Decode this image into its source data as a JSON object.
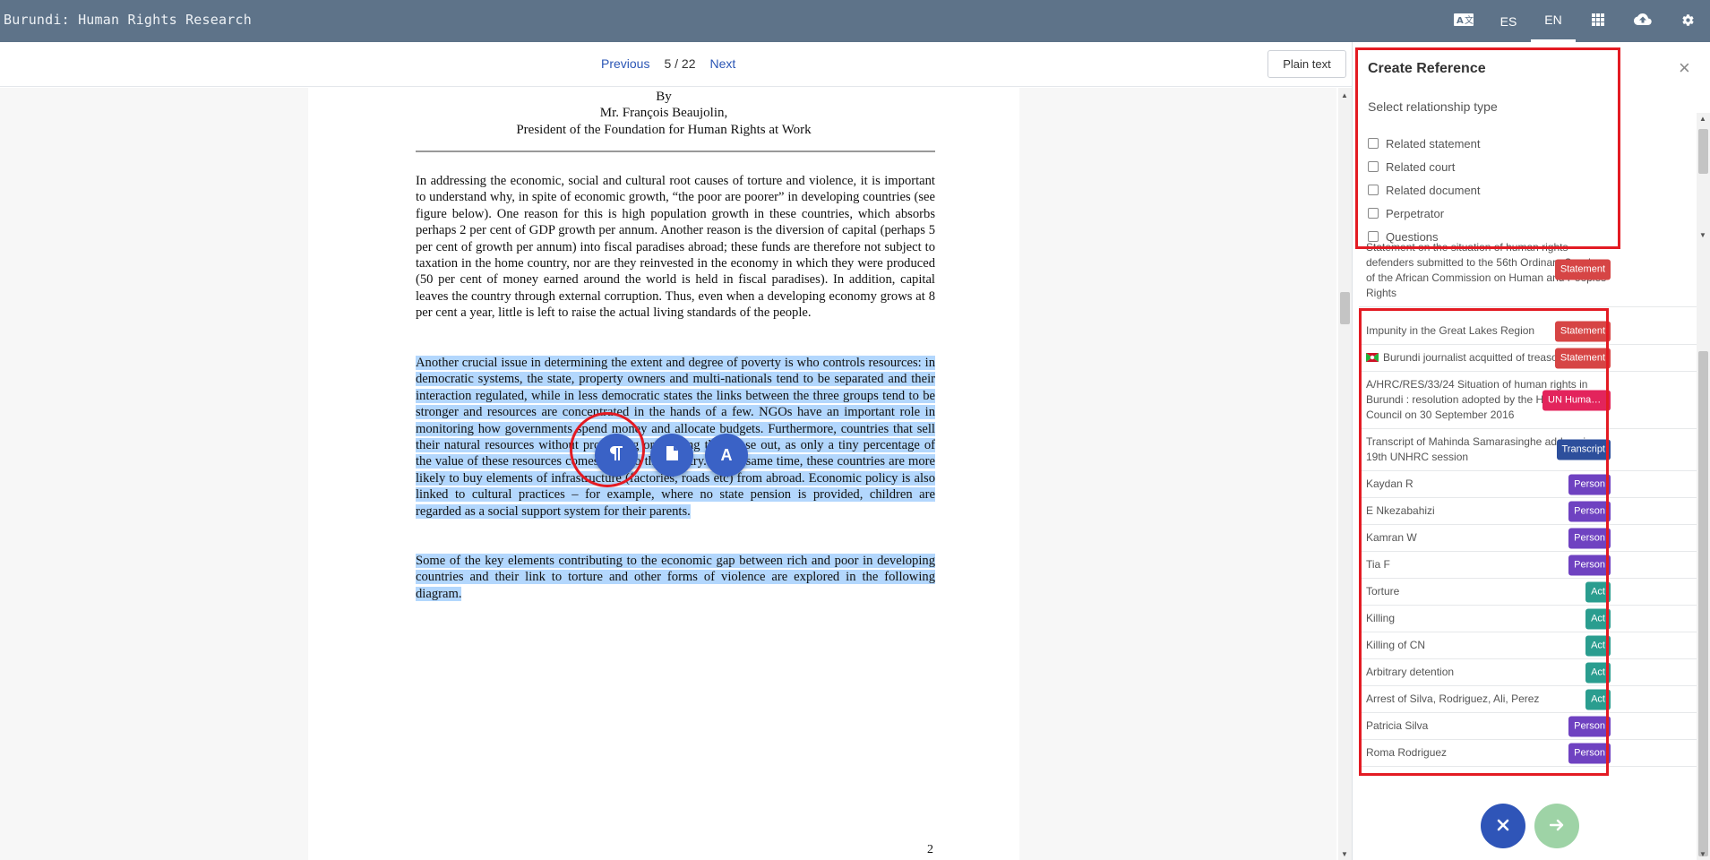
{
  "app": {
    "title": "Burundi: Human Rights Research"
  },
  "topbar": {
    "translate_icon": "translate-icon",
    "languages": [
      {
        "code": "ES",
        "active": false
      },
      {
        "code": "EN",
        "active": true
      }
    ],
    "apps_icon": "apps-grid-icon",
    "upload_icon": "cloud-upload-icon",
    "settings_icon": "gear-icon"
  },
  "viewer": {
    "previous": "Previous",
    "page_count": "5 / 22",
    "next": "Next",
    "plain_text": "Plain text"
  },
  "document": {
    "by": "By",
    "author": "Mr. François Beaujolin,",
    "role": "President of the Foundation for Human Rights at Work",
    "para1": "In addressing the economic, social and cultural root causes of torture and violence, it is important to understand why, in spite of economic growth, “the poor are poorer” in developing countries (see figure below). One reason for this is high population growth in these countries, which absorbs perhaps 2 per cent of GDP growth per annum. Another reason is the diversion of capital (perhaps 5 per cent of growth per annum) into fiscal paradises abroad; these funds are therefore not subject to taxation in the home country, nor are they reinvested in the economy in which they were produced (50 per cent of money earned around the world is held in fiscal paradises). In addition, capital leaves the country through external corruption. Thus, even when a developing economy grows at 8 per cent a year, little is left to raise the actual living standards of the people.",
    "para2": "Another crucial issue in determining the extent and degree of poverty is who controls resources: in democratic systems, the state, property owners and multi-nationals tend to be separated and their interaction regulated, while in less democratic states the links between the three groups tend to be stronger and resources are concentrated in the hands of a few. NGOs have an important role in monitoring how governments spend money and allocate budgets. Furthermore, countries that sell their natural resources without processing or refining them lose out, as only a tiny percentage of the value of these resources comes back to the country. At the same time, these countries are more likely to buy elements of infrastructure (factories, roads etc) from abroad. Economic policy is also linked to cultural practices – for example, where no state pension is provided, children are regarded as a social support system for their parents.",
    "para3": "Some of the key elements contributing to the economic gap between rich and poor in developing countries and their link to torture and other forms of violence are explored in the following diagram.",
    "page_number": "2"
  },
  "selection_actions": {
    "paragraph_icon": "paragraph-icon",
    "document_icon": "document-icon",
    "annotate_icon": "text-annotation-icon",
    "annotate_letter": "A"
  },
  "panel": {
    "title": "Create Reference",
    "close": "×",
    "select_label": "Select relationship type",
    "relationship_types": [
      "Related statement",
      "Related court",
      "Related document",
      "Perpetrator",
      "Questions"
    ],
    "results": [
      {
        "title": "Statement on the situation of human rights defenders submitted to the 56th Ordinary Session of the African Commission on Human and Peoples' Rights",
        "badge": "Statement",
        "color": "#d64545"
      },
      {
        "title": "Impunity in the Great Lakes Region",
        "badge": "Statement",
        "color": "#d64545"
      },
      {
        "title": "Burundi journalist acquitted of treason charges",
        "badge": "Statement",
        "color": "#d64545",
        "flag": true
      },
      {
        "title": " A/HRC/RES/33/24 Situation of human rights in Burundi : resolution adopted by the Human Rights Council on 30 September 2016",
        "badge": "UN Human ...",
        "color": "#e3245c"
      },
      {
        "title": "Transcript of Mahinda Samarasinghe addressing 19th UNHRC session",
        "badge": "Transcript",
        "color": "#2d4f9c"
      },
      {
        "title": "Kaydan R",
        "badge": "Person",
        "color": "#6f42c1"
      },
      {
        "title": "E Nkezabahizi",
        "badge": "Person",
        "color": "#6f42c1"
      },
      {
        "title": "Kamran W",
        "badge": "Person",
        "color": "#6f42c1"
      },
      {
        "title": "Tia F",
        "badge": "Person",
        "color": "#6f42c1"
      },
      {
        "title": "Torture",
        "badge": "Act",
        "color": "#2a9d8f"
      },
      {
        "title": "Killing",
        "badge": "Act",
        "color": "#2a9d8f"
      },
      {
        "title": "Killing of CN",
        "badge": "Act",
        "color": "#2a9d8f"
      },
      {
        "title": "Arbitrary detention",
        "badge": "Act",
        "color": "#2a9d8f"
      },
      {
        "title": "Arrest of Silva, Rodriguez, Ali, Perez",
        "badge": "Act",
        "color": "#2a9d8f"
      },
      {
        "title": "Patricia Silva",
        "badge": "Person",
        "color": "#6f42c1"
      },
      {
        "title": "Roma Rodriguez",
        "badge": "Person",
        "color": "#6f42c1"
      }
    ],
    "cancel_icon": "close-icon",
    "confirm_icon": "arrow-right-icon",
    "cancel_color": "#2f55b8",
    "confirm_color": "#9ed3a6"
  }
}
